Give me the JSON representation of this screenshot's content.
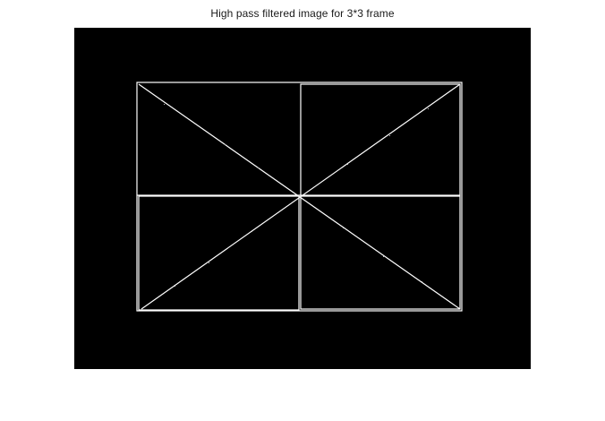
{
  "figure": {
    "title": "High pass filtered image for 3*3 frame"
  },
  "image": {
    "background_color": "#000000",
    "edge_color": "#ffffff",
    "content": "white edge outlines of a rectangular frame with two diagonals and a centered cross dividing it into quadrants"
  }
}
